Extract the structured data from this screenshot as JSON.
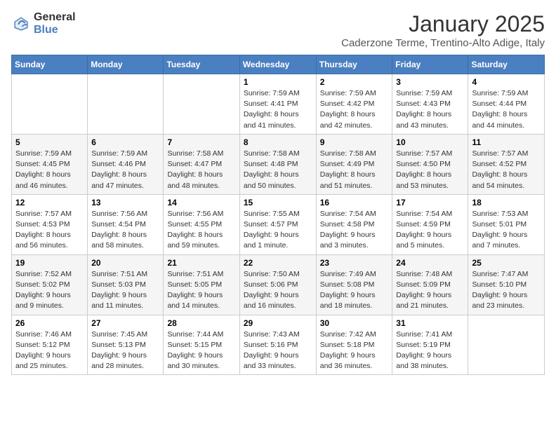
{
  "header": {
    "logo_general": "General",
    "logo_blue": "Blue",
    "month": "January 2025",
    "location": "Caderzone Terme, Trentino-Alto Adige, Italy"
  },
  "weekdays": [
    "Sunday",
    "Monday",
    "Tuesday",
    "Wednesday",
    "Thursday",
    "Friday",
    "Saturday"
  ],
  "weeks": [
    [
      {
        "day": "",
        "info": ""
      },
      {
        "day": "",
        "info": ""
      },
      {
        "day": "",
        "info": ""
      },
      {
        "day": "1",
        "info": "Sunrise: 7:59 AM\nSunset: 4:41 PM\nDaylight: 8 hours and 41 minutes."
      },
      {
        "day": "2",
        "info": "Sunrise: 7:59 AM\nSunset: 4:42 PM\nDaylight: 8 hours and 42 minutes."
      },
      {
        "day": "3",
        "info": "Sunrise: 7:59 AM\nSunset: 4:43 PM\nDaylight: 8 hours and 43 minutes."
      },
      {
        "day": "4",
        "info": "Sunrise: 7:59 AM\nSunset: 4:44 PM\nDaylight: 8 hours and 44 minutes."
      }
    ],
    [
      {
        "day": "5",
        "info": "Sunrise: 7:59 AM\nSunset: 4:45 PM\nDaylight: 8 hours and 46 minutes."
      },
      {
        "day": "6",
        "info": "Sunrise: 7:59 AM\nSunset: 4:46 PM\nDaylight: 8 hours and 47 minutes."
      },
      {
        "day": "7",
        "info": "Sunrise: 7:58 AM\nSunset: 4:47 PM\nDaylight: 8 hours and 48 minutes."
      },
      {
        "day": "8",
        "info": "Sunrise: 7:58 AM\nSunset: 4:48 PM\nDaylight: 8 hours and 50 minutes."
      },
      {
        "day": "9",
        "info": "Sunrise: 7:58 AM\nSunset: 4:49 PM\nDaylight: 8 hours and 51 minutes."
      },
      {
        "day": "10",
        "info": "Sunrise: 7:57 AM\nSunset: 4:50 PM\nDaylight: 8 hours and 53 minutes."
      },
      {
        "day": "11",
        "info": "Sunrise: 7:57 AM\nSunset: 4:52 PM\nDaylight: 8 hours and 54 minutes."
      }
    ],
    [
      {
        "day": "12",
        "info": "Sunrise: 7:57 AM\nSunset: 4:53 PM\nDaylight: 8 hours and 56 minutes."
      },
      {
        "day": "13",
        "info": "Sunrise: 7:56 AM\nSunset: 4:54 PM\nDaylight: 8 hours and 58 minutes."
      },
      {
        "day": "14",
        "info": "Sunrise: 7:56 AM\nSunset: 4:55 PM\nDaylight: 8 hours and 59 minutes."
      },
      {
        "day": "15",
        "info": "Sunrise: 7:55 AM\nSunset: 4:57 PM\nDaylight: 9 hours and 1 minute."
      },
      {
        "day": "16",
        "info": "Sunrise: 7:54 AM\nSunset: 4:58 PM\nDaylight: 9 hours and 3 minutes."
      },
      {
        "day": "17",
        "info": "Sunrise: 7:54 AM\nSunset: 4:59 PM\nDaylight: 9 hours and 5 minutes."
      },
      {
        "day": "18",
        "info": "Sunrise: 7:53 AM\nSunset: 5:01 PM\nDaylight: 9 hours and 7 minutes."
      }
    ],
    [
      {
        "day": "19",
        "info": "Sunrise: 7:52 AM\nSunset: 5:02 PM\nDaylight: 9 hours and 9 minutes."
      },
      {
        "day": "20",
        "info": "Sunrise: 7:51 AM\nSunset: 5:03 PM\nDaylight: 9 hours and 11 minutes."
      },
      {
        "day": "21",
        "info": "Sunrise: 7:51 AM\nSunset: 5:05 PM\nDaylight: 9 hours and 14 minutes."
      },
      {
        "day": "22",
        "info": "Sunrise: 7:50 AM\nSunset: 5:06 PM\nDaylight: 9 hours and 16 minutes."
      },
      {
        "day": "23",
        "info": "Sunrise: 7:49 AM\nSunset: 5:08 PM\nDaylight: 9 hours and 18 minutes."
      },
      {
        "day": "24",
        "info": "Sunrise: 7:48 AM\nSunset: 5:09 PM\nDaylight: 9 hours and 21 minutes."
      },
      {
        "day": "25",
        "info": "Sunrise: 7:47 AM\nSunset: 5:10 PM\nDaylight: 9 hours and 23 minutes."
      }
    ],
    [
      {
        "day": "26",
        "info": "Sunrise: 7:46 AM\nSunset: 5:12 PM\nDaylight: 9 hours and 25 minutes."
      },
      {
        "day": "27",
        "info": "Sunrise: 7:45 AM\nSunset: 5:13 PM\nDaylight: 9 hours and 28 minutes."
      },
      {
        "day": "28",
        "info": "Sunrise: 7:44 AM\nSunset: 5:15 PM\nDaylight: 9 hours and 30 minutes."
      },
      {
        "day": "29",
        "info": "Sunrise: 7:43 AM\nSunset: 5:16 PM\nDaylight: 9 hours and 33 minutes."
      },
      {
        "day": "30",
        "info": "Sunrise: 7:42 AM\nSunset: 5:18 PM\nDaylight: 9 hours and 36 minutes."
      },
      {
        "day": "31",
        "info": "Sunrise: 7:41 AM\nSunset: 5:19 PM\nDaylight: 9 hours and 38 minutes."
      },
      {
        "day": "",
        "info": ""
      }
    ]
  ]
}
